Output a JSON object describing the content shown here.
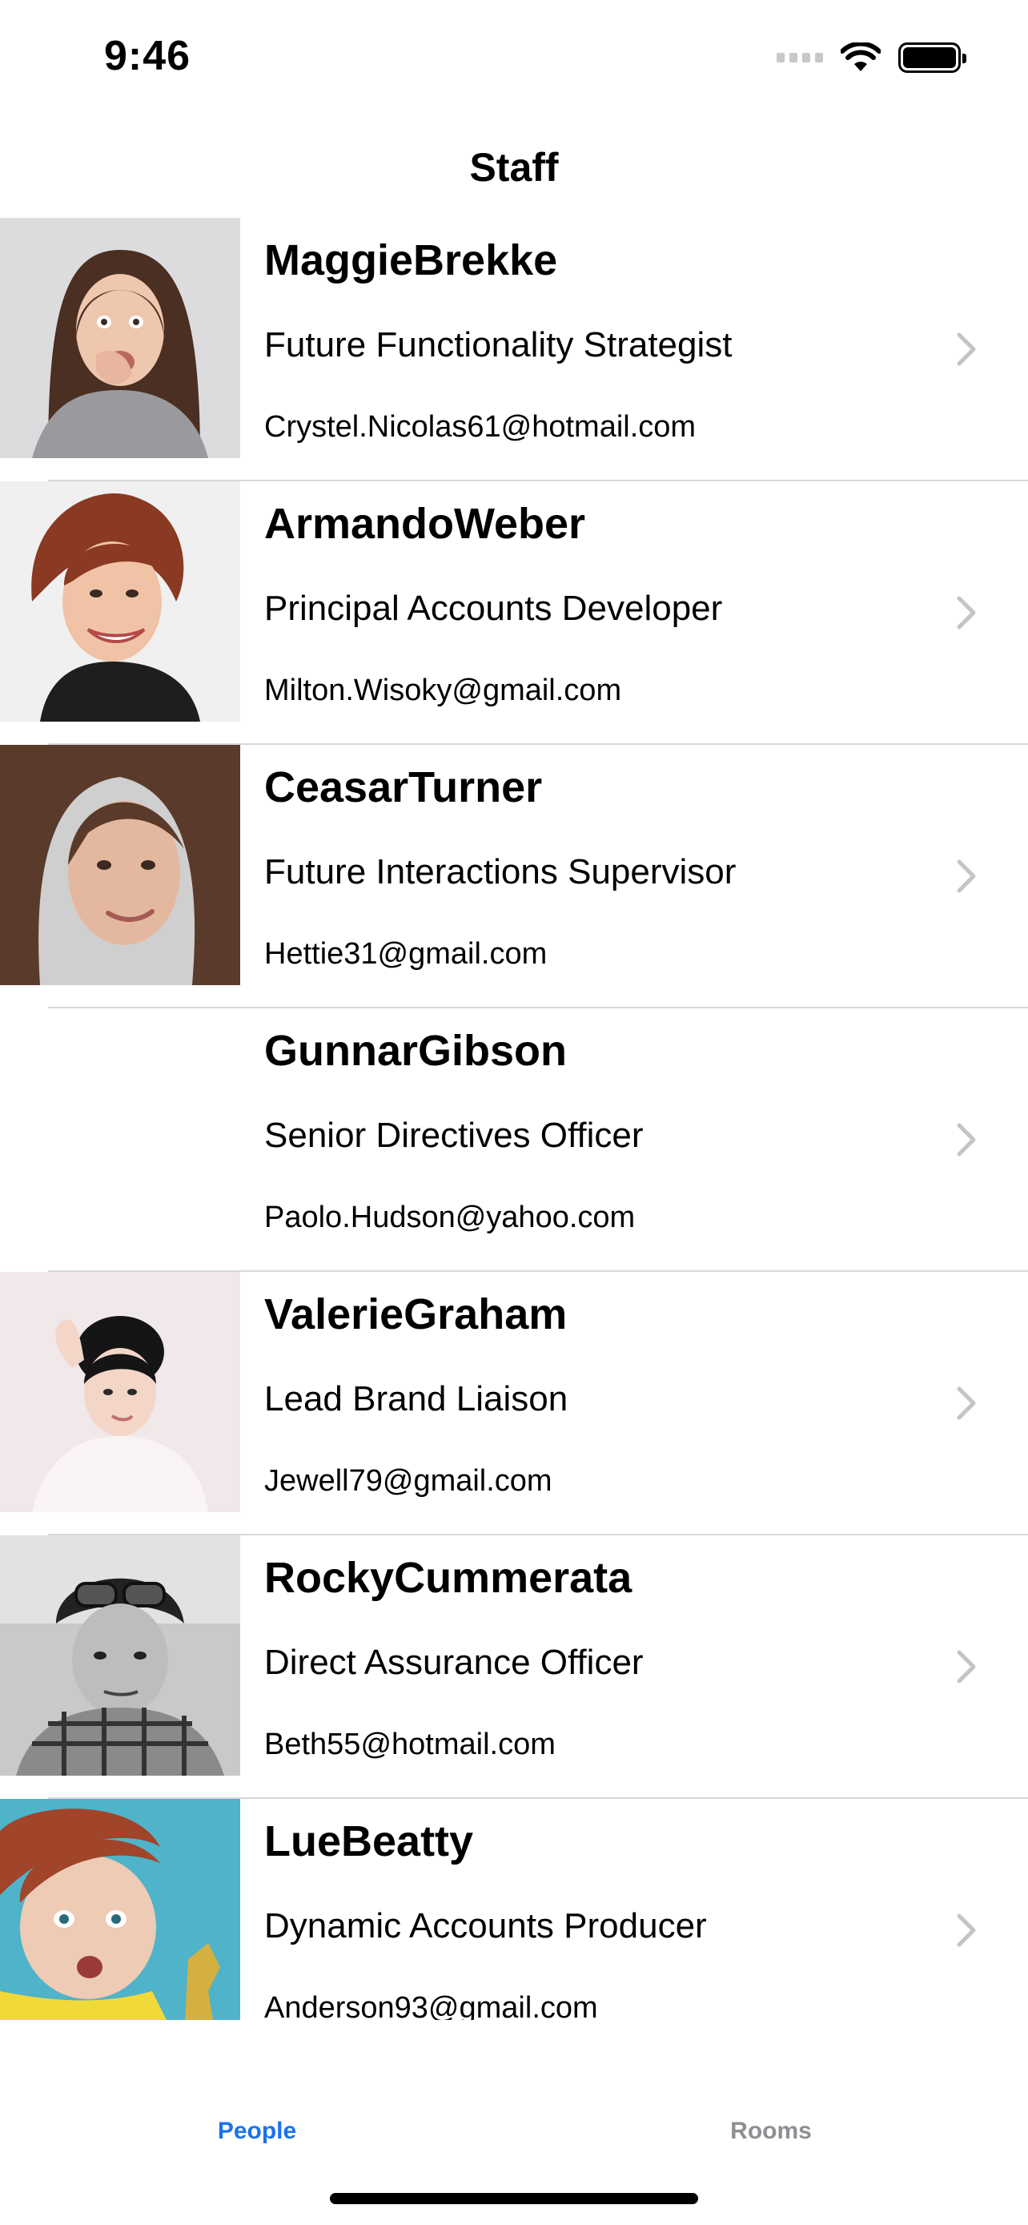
{
  "status": {
    "time": "9:46"
  },
  "nav": {
    "title": "Staff"
  },
  "people": [
    {
      "name": "MaggieBrekke",
      "title": "Future Functionality Strategist",
      "email": "Crystel.Nicolas61@hotmail.com"
    },
    {
      "name": "ArmandoWeber",
      "title": "Principal Accounts Developer",
      "email": "Milton.Wisoky@gmail.com"
    },
    {
      "name": "CeasarTurner",
      "title": "Future Interactions Supervisor",
      "email": "Hettie31@gmail.com"
    },
    {
      "name": "GunnarGibson",
      "title": "Senior Directives Officer",
      "email": "Paolo.Hudson@yahoo.com"
    },
    {
      "name": "ValerieGraham",
      "title": "Lead Brand Liaison",
      "email": "Jewell79@gmail.com"
    },
    {
      "name": "RockyCummerata",
      "title": "Direct Assurance Officer",
      "email": "Beth55@hotmail.com"
    },
    {
      "name": "LueBeatty",
      "title": "Dynamic Accounts Producer",
      "email": "Anderson93@gmail.com"
    }
  ],
  "tabs": {
    "people": "People",
    "rooms": "Rooms"
  },
  "colors": {
    "accent": "#1a73e8",
    "inactive_tab": "#8e8e93",
    "separator": "#d8d8dc",
    "chevron": "#c4c4c7"
  },
  "icons": {
    "row_accessory": "chevron-right-icon",
    "wifi": "wifi-icon",
    "battery": "battery-icon",
    "signal": "signal-icon"
  }
}
